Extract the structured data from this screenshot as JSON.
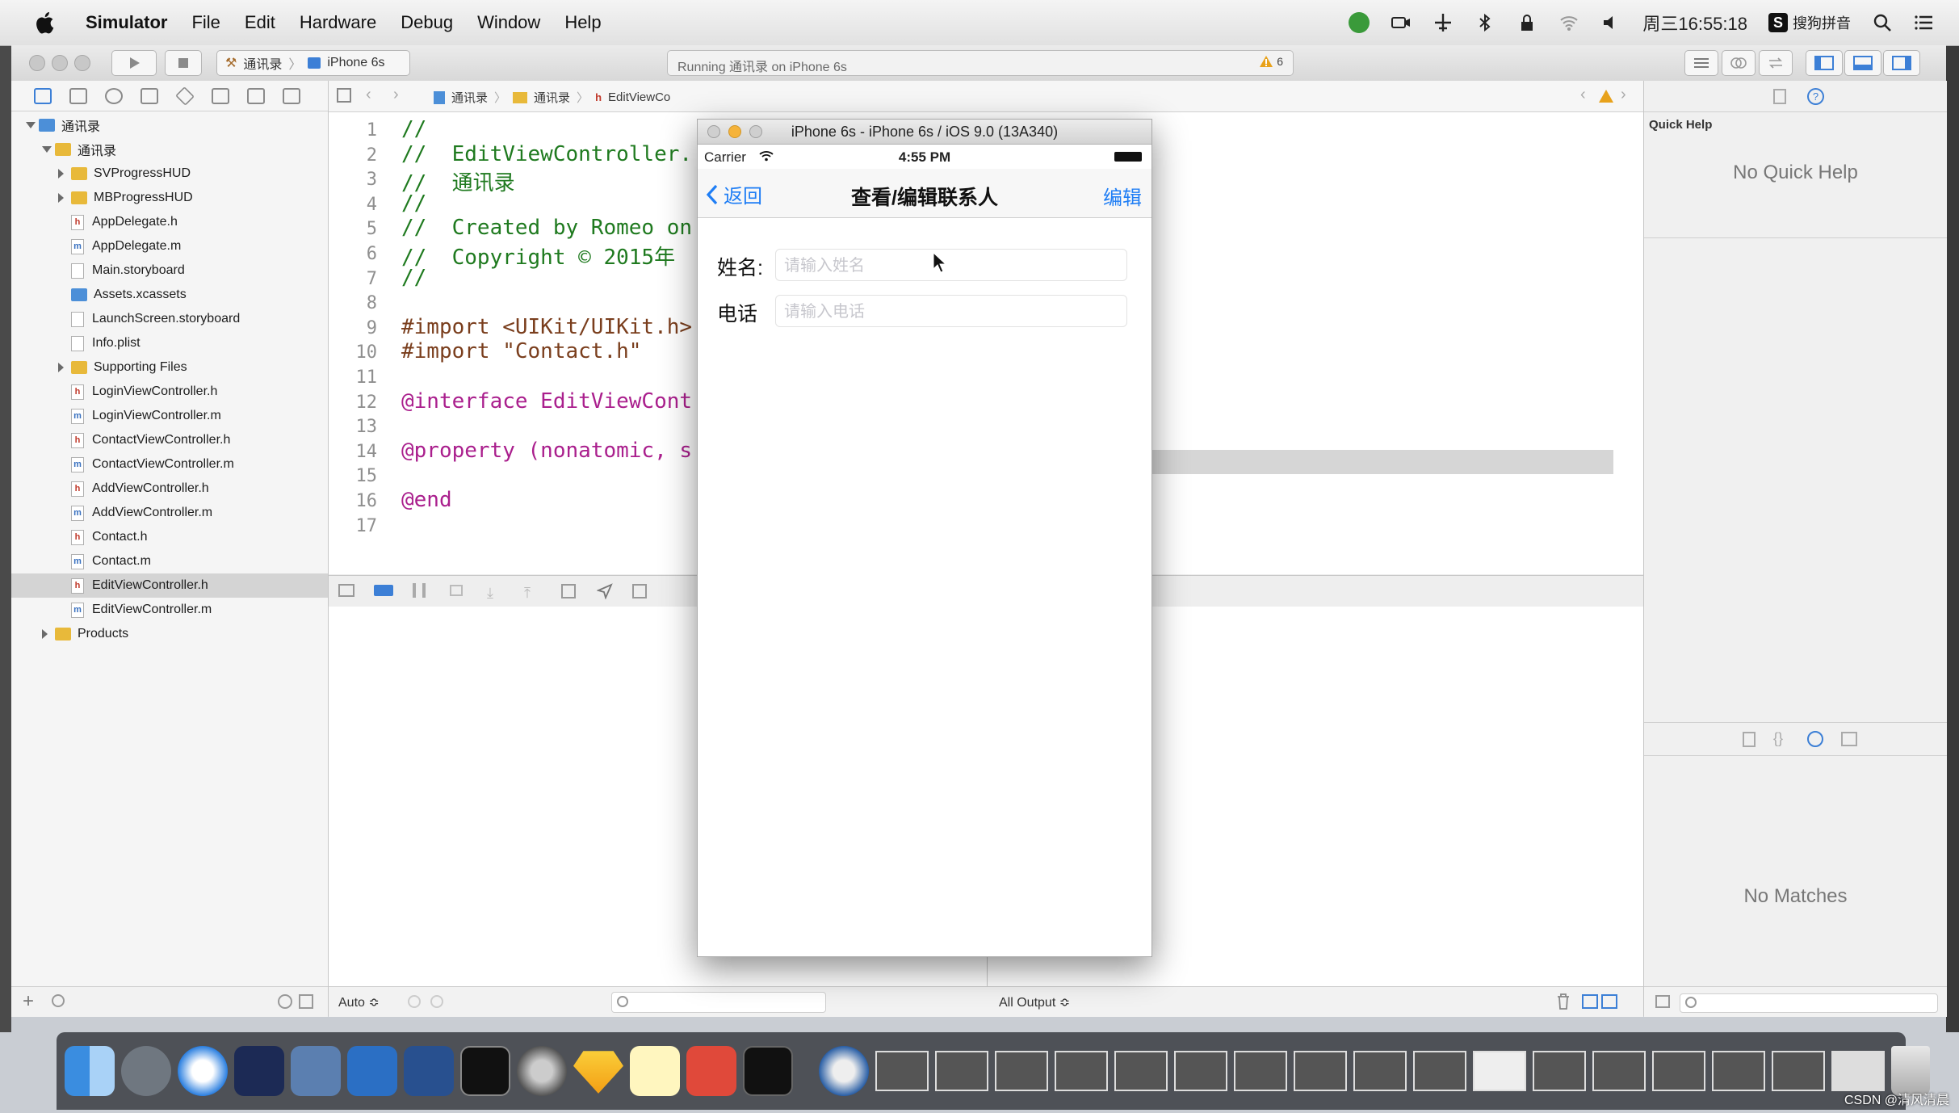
{
  "menubar": {
    "app_name": "Simulator",
    "items": [
      "File",
      "Edit",
      "Hardware",
      "Debug",
      "Window",
      "Help"
    ],
    "clock": "周三16:55:18",
    "input_method": "搜狗拼音"
  },
  "toolbar": {
    "scheme": "通讯录",
    "device": "iPhone 6s",
    "status": "Running 通讯录 on iPhone 6s",
    "warnings": "6"
  },
  "jumpbar": {
    "crumbs": [
      "通讯录",
      "通讯录",
      "EditViewCo"
    ]
  },
  "navigator": {
    "items": [
      {
        "label": "通讯录",
        "type": "project",
        "indent": 0,
        "disclosure": "open"
      },
      {
        "label": "通讯录",
        "type": "folder",
        "indent": 1,
        "disclosure": "open"
      },
      {
        "label": "SVProgressHUD",
        "type": "folder",
        "indent": 2,
        "disclosure": "closed"
      },
      {
        "label": "MBProgressHUD",
        "type": "folder",
        "indent": 2,
        "disclosure": "closed"
      },
      {
        "label": "AppDelegate.h",
        "type": "h",
        "indent": 2
      },
      {
        "label": "AppDelegate.m",
        "type": "m",
        "indent": 2
      },
      {
        "label": "Main.storyboard",
        "type": "sb",
        "indent": 2
      },
      {
        "label": "Assets.xcassets",
        "type": "assets",
        "indent": 2
      },
      {
        "label": "LaunchScreen.storyboard",
        "type": "sb",
        "indent": 2
      },
      {
        "label": "Info.plist",
        "type": "pl",
        "indent": 2
      },
      {
        "label": "Supporting Files",
        "type": "folder",
        "indent": 2,
        "disclosure": "closed"
      },
      {
        "label": "LoginViewController.h",
        "type": "h",
        "indent": 2
      },
      {
        "label": "LoginViewController.m",
        "type": "m",
        "indent": 2
      },
      {
        "label": "ContactViewController.h",
        "type": "h",
        "indent": 2
      },
      {
        "label": "ContactViewController.m",
        "type": "m",
        "indent": 2
      },
      {
        "label": "AddViewController.h",
        "type": "h",
        "indent": 2
      },
      {
        "label": "AddViewController.m",
        "type": "m",
        "indent": 2
      },
      {
        "label": "Contact.h",
        "type": "h",
        "indent": 2
      },
      {
        "label": "Contact.m",
        "type": "m",
        "indent": 2
      },
      {
        "label": "EditViewController.h",
        "type": "h",
        "indent": 2,
        "selected": true
      },
      {
        "label": "EditViewController.m",
        "type": "m",
        "indent": 2
      },
      {
        "label": "Products",
        "type": "folder",
        "indent": 1,
        "disclosure": "closed"
      }
    ]
  },
  "code": {
    "lines": [
      "//",
      "//  EditViewController.",
      "//  通讯录",
      "//",
      "//  Created by Romeo on",
      "//  Copyright © 2015年",
      "//",
      "",
      "#import <UIKit/UIKit.h>",
      "#import \"Contact.h\"",
      "",
      "@interface EditViewCont",
      "",
      "@property (nonatomic, s",
      "",
      "@end",
      ""
    ]
  },
  "simulator": {
    "window_title": "iPhone 6s - iPhone 6s / iOS 9.0 (13A340)",
    "carrier": "Carrier",
    "time": "4:55 PM",
    "nav_back": "返回",
    "nav_title": "查看/编辑联系人",
    "nav_edit": "编辑",
    "name_label": "姓名:",
    "name_placeholder": "请输入姓名",
    "phone_label": "电话",
    "phone_placeholder": "请输入电话"
  },
  "inspector": {
    "quick_help_title": "Quick Help",
    "no_quick_help": "No Quick Help",
    "no_matches": "No Matches"
  },
  "bottombar": {
    "auto_label": "Auto ≎",
    "output_label": "All Output ≎"
  },
  "watermark": "CSDN @清风清晨",
  "colors": {
    "ios_blue": "#1f7ef5",
    "comment_green": "#1f7a1f",
    "keyword_purple": "#aa1f8d",
    "string_red": "#c41a16"
  }
}
